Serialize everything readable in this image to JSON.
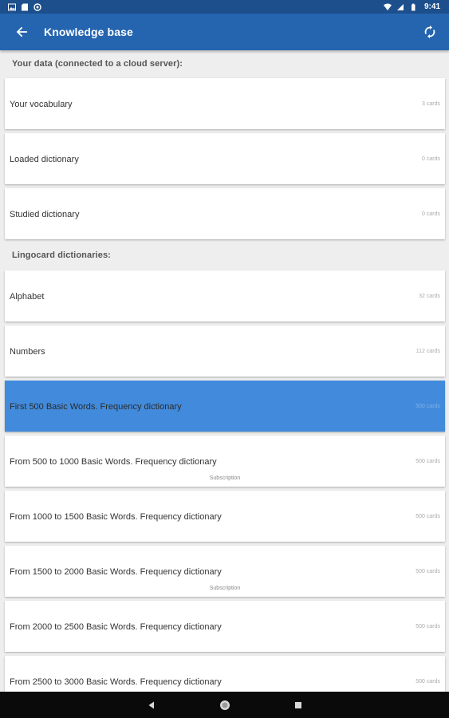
{
  "status_bar": {
    "time": "9:41",
    "left_icons": [
      "gallery-icon",
      "sd-card-icon",
      "sync-status-icon"
    ],
    "right_icons": [
      "wifi-icon",
      "signal-icon",
      "battery-icon"
    ]
  },
  "app_bar": {
    "title": "Knowledge base",
    "back_icon": "arrow-back-icon",
    "action_icon": "sync-icon",
    "background": "#2565b0"
  },
  "sections": [
    {
      "header": "Your data (connected to a cloud server):",
      "items": [
        {
          "title": "Your vocabulary",
          "count": "3 cards"
        },
        {
          "title": "Loaded dictionary",
          "count": "0 cards"
        },
        {
          "title": "Studied dictionary",
          "count": "0 cards"
        }
      ]
    },
    {
      "header": "Lingocard dictionaries:",
      "items": [
        {
          "title": "Alphabet",
          "count": "32 cards"
        },
        {
          "title": "Numbers",
          "count": "112 cards"
        },
        {
          "title": "First 500 Basic Words. Frequency dictionary",
          "count": "500 cards",
          "selected": true
        },
        {
          "title": "From 500 to 1000 Basic Words. Frequency dictionary",
          "count": "500 cards",
          "subtitle": "Subscription"
        },
        {
          "title": "From 1000 to 1500 Basic Words. Frequency dictionary",
          "count": "500 cards"
        },
        {
          "title": "From 1500 to 2000 Basic Words. Frequency dictionary",
          "count": "500 cards",
          "subtitle": "Subscription"
        },
        {
          "title": "From 2000 to 2500 Basic Words. Frequency dictionary",
          "count": "500 cards"
        },
        {
          "title": "From 2500 to 3000 Basic Words. Frequency dictionary",
          "count": "500 cards"
        }
      ]
    }
  ],
  "colors": {
    "selected_card": "#428bdc",
    "status_bar": "#1c4f8c"
  },
  "nav_bar": {
    "buttons": [
      "back-triangle-icon",
      "home-circle-icon",
      "recents-square-icon"
    ]
  }
}
